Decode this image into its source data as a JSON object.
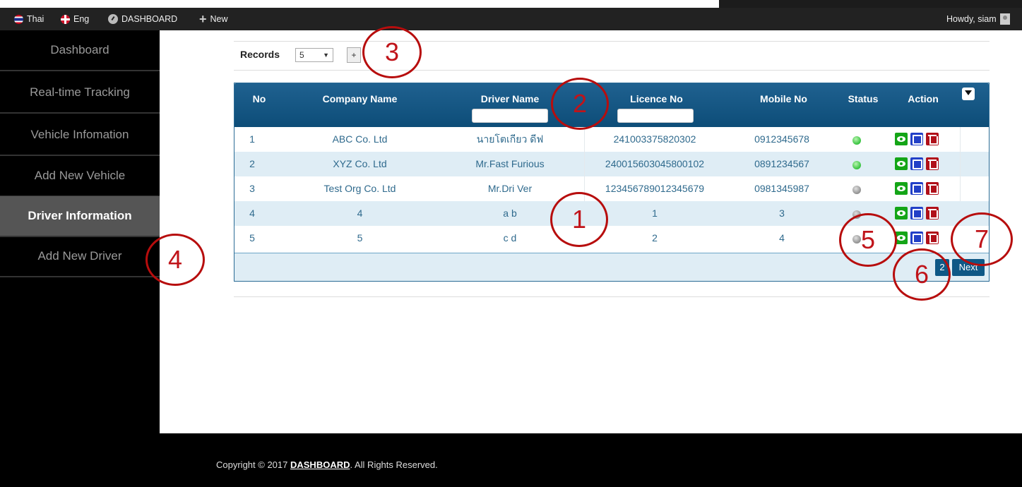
{
  "adminbar": {
    "lang_thai": "Thai",
    "lang_eng": "Eng",
    "dashboard": "DASHBOARD",
    "new": "New",
    "howdy": "Howdy, siam"
  },
  "sidebar": {
    "items": [
      {
        "label": "Dashboard",
        "active": false
      },
      {
        "label": "Real-time Tracking",
        "active": false
      },
      {
        "label": "Vehicle Infomation",
        "active": false
      },
      {
        "label": "Add New Vehicle",
        "active": false
      },
      {
        "label": "Driver Information",
        "active": true
      },
      {
        "label": "Add New Driver",
        "active": false
      }
    ]
  },
  "records": {
    "label": "Records",
    "selected": "5",
    "add_label": "+"
  },
  "table": {
    "headers": {
      "no": "No",
      "company": "Company Name",
      "driver": "Driver Name",
      "licence": "Licence No",
      "mobile": "Mobile No",
      "status": "Status",
      "action": "Action"
    },
    "rows": [
      {
        "no": "1",
        "company": "ABC Co. Ltd",
        "driver": "นายโตเกียว ดีฟ",
        "licence": "241003375820302",
        "mobile": "0912345678",
        "status": "green"
      },
      {
        "no": "2",
        "company": "XYZ Co. Ltd",
        "driver": "Mr.Fast Furious",
        "licence": "240015603045800102",
        "mobile": "0891234567",
        "status": "green"
      },
      {
        "no": "3",
        "company": "Test Org Co. Ltd",
        "driver": "Mr.Dri Ver",
        "licence": "123456789012345679",
        "mobile": "0981345987",
        "status": "gray"
      },
      {
        "no": "4",
        "company": "4",
        "driver": "a b",
        "licence": "1",
        "mobile": "3",
        "status": "gray"
      },
      {
        "no": "5",
        "company": "5",
        "driver": "c d",
        "licence": "2",
        "mobile": "4",
        "status": "gray"
      }
    ],
    "pagination": {
      "page": "2",
      "next": "Next"
    }
  },
  "footer": {
    "prefix": "Copyright © 2017 ",
    "brand": "DASHBOARD",
    "suffix": ". All Rights Reserved."
  },
  "annotations": [
    "1",
    "2",
    "3",
    "4",
    "5",
    "6",
    "7"
  ],
  "colors": {
    "header_blue": "#1f6190",
    "row_alt": "#dfedf5",
    "status_green": "#36c23e",
    "status_gray": "#8a8a8a",
    "annotation_red": "#b70d0d"
  }
}
